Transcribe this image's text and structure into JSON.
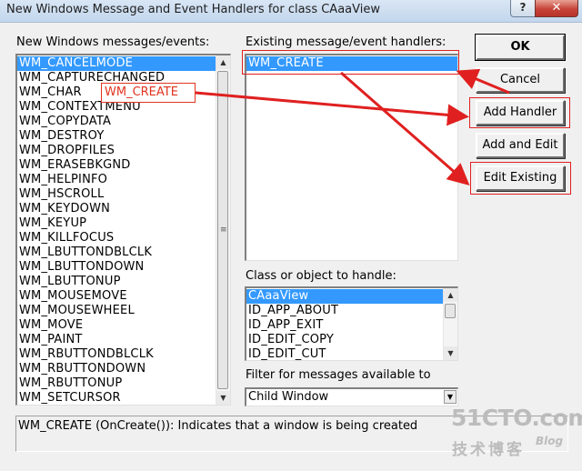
{
  "window": {
    "title": "New Windows Message and Event Handlers for class CAaaView",
    "help_glyph": "?",
    "close_glyph": "✕"
  },
  "messages_panel": {
    "label": "New Windows messages/events:",
    "items": [
      "WM_CANCELMODE",
      "WM_CAPTURECHANGED",
      "WM_CHAR",
      "WM_CONTEXTMENU",
      "WM_COPYDATA",
      "WM_DESTROY",
      "WM_DROPFILES",
      "WM_ERASEBKGND",
      "WM_HELPINFO",
      "WM_HSCROLL",
      "WM_KEYDOWN",
      "WM_KEYUP",
      "WM_KILLFOCUS",
      "WM_LBUTTONDBLCLK",
      "WM_LBUTTONDOWN",
      "WM_LBUTTONUP",
      "WM_MOUSEMOVE",
      "WM_MOUSEWHEEL",
      "WM_MOVE",
      "WM_PAINT",
      "WM_RBUTTONDBLCLK",
      "WM_RBUTTONDOWN",
      "WM_RBUTTONUP",
      "WM_SETCURSOR"
    ],
    "selected": "WM_CANCELMODE"
  },
  "handlers_panel": {
    "label": "Existing message/event handlers:",
    "items": [
      "WM_CREATE"
    ],
    "selected": "WM_CREATE"
  },
  "class_panel": {
    "label": "Class or object to handle:",
    "items": [
      "CAaaView",
      "ID_APP_ABOUT",
      "ID_APP_EXIT",
      "ID_EDIT_COPY",
      "ID_EDIT_CUT"
    ],
    "selected": "CAaaView"
  },
  "filter": {
    "label": "Filter for messages available to",
    "value": "Child Window"
  },
  "buttons": {
    "ok": "OK",
    "cancel": "Cancel",
    "add_handler": "Add Handler",
    "add_and_edit": "Add and Edit",
    "edit_existing": "Edit Existing"
  },
  "status": {
    "text": "WM_CREATE (OnCreate()):  Indicates that a window is being created"
  },
  "annotation": {
    "callout_text": "WM_CREATE",
    "color": "#e0341e"
  },
  "watermark": {
    "main": "51CTO.com",
    "sub": "技术博客",
    "blog": "Blog"
  },
  "colors": {
    "selection": "#3399ff",
    "dialog_bg": "#f0f0f0"
  }
}
